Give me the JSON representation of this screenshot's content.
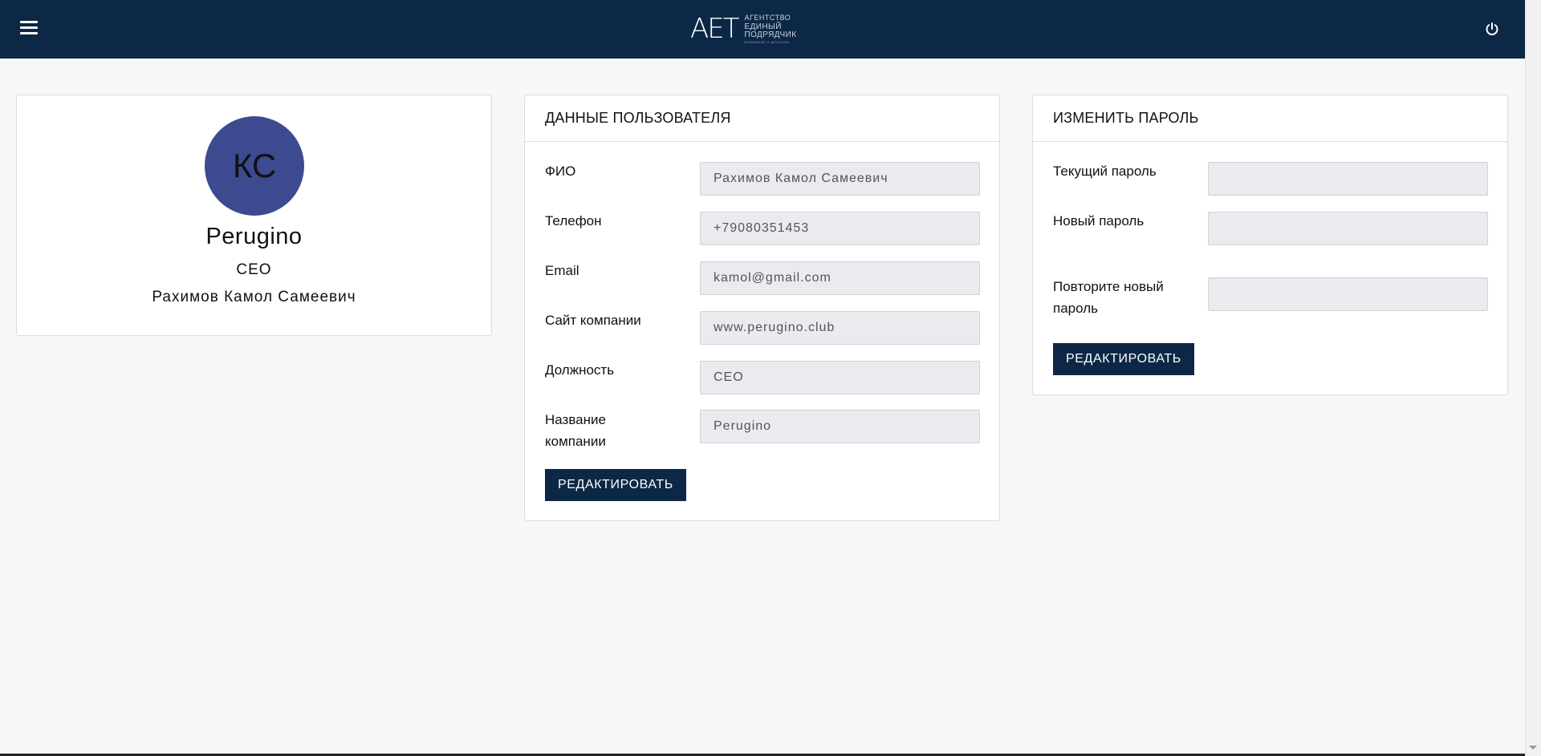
{
  "header": {
    "menu_icon": "hamburger-icon",
    "logo_mark": "AET",
    "logo_line1": "АГЕНТСТВО",
    "logo_line2": "ЕДИНЫЙ ПОДРЯДЧИК",
    "logo_line3": "ВНИМАНИЕ К ДЕТАЛЯМ",
    "power_icon": "power-icon",
    "bg_color": "#0c2846"
  },
  "profile": {
    "initials": "КС",
    "company": "Perugino",
    "role": "CEO",
    "full_name": "Рахимов Камол Самеевич",
    "avatar_color": "#3d4a90"
  },
  "user_data": {
    "title": "ДАННЫЕ ПОЛЬЗОВАТЕЛЯ",
    "fields": [
      {
        "label": "ФИО",
        "value": "Рахимов Камол Самеевич"
      },
      {
        "label": "Телефон",
        "value": "+79080351453"
      },
      {
        "label": "Email",
        "value": "kamol@gmail.com"
      },
      {
        "label": "Сайт компании",
        "value": "www.perugino.club"
      },
      {
        "label": "Должность",
        "value": "CEO"
      },
      {
        "label": "Название компании",
        "value": "Perugino"
      }
    ],
    "button": "РЕДАКТИРОВАТЬ"
  },
  "change_password": {
    "title": "ИЗМЕНИТЬ ПАРОЛЬ",
    "fields": [
      {
        "label": "Текущий пароль",
        "value": ""
      },
      {
        "label": "Новый пароль",
        "value": ""
      },
      {
        "label": "Повторите новый пароль",
        "value": ""
      }
    ],
    "button": "РЕДАКТИРОВАТЬ"
  }
}
